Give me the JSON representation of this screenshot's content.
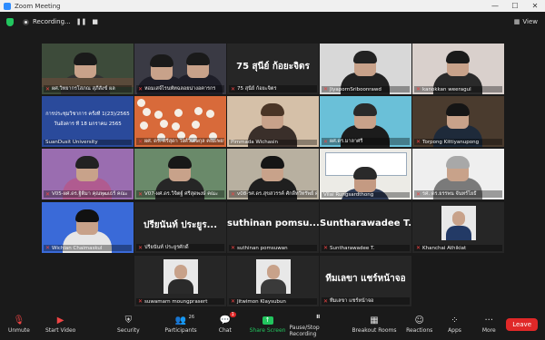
{
  "window": {
    "title": "Zoom Meeting",
    "win_min": "—",
    "win_max": "☐",
    "win_close": "✕"
  },
  "topbar": {
    "recording_label": "Recording...",
    "pause_glyph": "❚❚",
    "stop_glyph": "■",
    "view_label": "View"
  },
  "tiles": [
    {
      "label": "ผศ.วิทยากรโสภณ สุภีสังข์ ผล",
      "muted": true,
      "active": true,
      "scene": "desk",
      "bg": "#3d4b3a"
    },
    {
      "label": "หอมเสจ์ไรนพัทฉลอยน่างอคารกร",
      "muted": true,
      "scene": "two",
      "bg": "#3a3a44"
    },
    {
      "label": "75 สุนีย์ ก้อยะจิตร",
      "muted": true,
      "scene": "name",
      "big": "75 สุนีย์ ก้อยะจิตร",
      "bg": "#262626"
    },
    {
      "label": "JiyapornSriboonrawd",
      "muted": true,
      "scene": "person",
      "bg": "#d8d8d8",
      "body": "#222",
      "hair": "#222"
    },
    {
      "label": "kanokkan weeragul",
      "muted": true,
      "scene": "person",
      "bg": "#d9d0cc",
      "body": "#2a2a2a",
      "hair": "#1a1a1a"
    },
    {
      "label": "SuanDusit University",
      "muted": false,
      "scene": "slide",
      "bg": "#2a4a9b",
      "slide1": "การประชุมวิชาการ ครั้งที่ 1(23)/2565",
      "slide2": "วันอังคาร ที่ 18 มกราคม 2565"
    },
    {
      "label": "ผศ. ดร. ศรีสุดา วงศ์วิเศษกุล คณะพยาบาล",
      "muted": true,
      "scene": "flowers",
      "bg": "#d86a3a"
    },
    {
      "label": "Pimmada Wichasin",
      "muted": false,
      "scene": "person",
      "bg": "#d5c0a8",
      "body": "#3a2f2a",
      "hair": "#4a3526"
    },
    {
      "label": "ผศ.ดร.มาลาศรี",
      "muted": true,
      "scene": "person",
      "bg": "#6ac0d8",
      "body": "#1c1c1c",
      "hair": "#2a2a2a"
    },
    {
      "label": "Torpong Kittiyanupong",
      "muted": true,
      "scene": "person",
      "bg": "#4a3b2e",
      "body": "#1e2a3a",
      "hair": "#151515"
    },
    {
      "label": "V05-ผศ.ดร.ฐิติมา คุณพุฒเธร์ คณะ",
      "muted": true,
      "scene": "person",
      "bg": "#9a6db0",
      "body": "#b05b90",
      "hair": "#222"
    },
    {
      "label": "V07-ผศ.ดร.วิจิตฐ์ ศรีสุดพงษ์ คณะ",
      "muted": true,
      "scene": "person",
      "bg": "#6a8a6a",
      "body": "#262626",
      "hair": "#181818"
    },
    {
      "label": "v08-รศ.ดร.สุขสวรรค์ ศักดิ์ทวีทรัพย์ คณะ",
      "muted": true,
      "scene": "person",
      "bg": "#b8b0a0",
      "body": "#1f1f1f",
      "hair": "#151515"
    },
    {
      "label": "Vilai Rungsardthong",
      "muted": false,
      "scene": "poster",
      "bg": "#ecebe6",
      "body": "#2d3a55",
      "hair": "#2a2a2a"
    },
    {
      "label": "รศ. ดร.ยรรพน จันทร์โยธี",
      "muted": true,
      "scene": "person",
      "bg": "#efefef",
      "body": "#7a7a7a",
      "hair": "#a8a8a8"
    },
    {
      "label": "Wichian Chaimaskul",
      "muted": true,
      "scene": "person",
      "bg": "#3a6ad8",
      "body": "#e6e6e6",
      "hair": "#111"
    },
    {
      "label": "ปรียนันท์ ประยูรศักดิ์",
      "muted": true,
      "scene": "name",
      "big": "ปรียนันท์ ประยูร...",
      "bg": "#262626"
    },
    {
      "label": "suthinan pomsuwan",
      "muted": true,
      "scene": "name",
      "big": "suthinan pomsu...",
      "bg": "#262626"
    },
    {
      "label": "Suntharawadee T.",
      "muted": true,
      "scene": "name",
      "big": "Suntharawadee T.",
      "bg": "#262626"
    },
    {
      "label": "Khanchai Athikiat",
      "muted": true,
      "scene": "card",
      "bg": "#262626",
      "body": "#233a66",
      "hair": "#1a1a1a"
    },
    {
      "label": "suwamarn moungprasert",
      "muted": true,
      "scene": "card",
      "bg": "#262626",
      "body": "#2a2a2a",
      "hair": "#151515"
    },
    {
      "label": "Jitwimon Klaysubun",
      "muted": true,
      "scene": "card",
      "bg": "#262626",
      "body": "#3a3a3a",
      "hair": "#1a1a1a"
    },
    {
      "label": "ทีมเลขา แชร์หน้าจอ",
      "muted": true,
      "scene": "name",
      "big": "ทีมเลขา แชร์หน้าจอ",
      "bg": "#262626"
    }
  ],
  "toolbar": {
    "unmute": "Unmute",
    "start_video": "Start Video",
    "security": "Security",
    "participants": "Participants",
    "participants_count": "26",
    "chat": "Chat",
    "chat_badge": "1",
    "share_screen": "Share Screen",
    "pause_stop_recording": "Pause/Stop Recording",
    "breakout_rooms": "Breakout Rooms",
    "reactions": "Reactions",
    "apps": "Apps",
    "more": "More",
    "leave": "Leave",
    "share_color": "#22c55e",
    "leave_color": "#e02828"
  }
}
